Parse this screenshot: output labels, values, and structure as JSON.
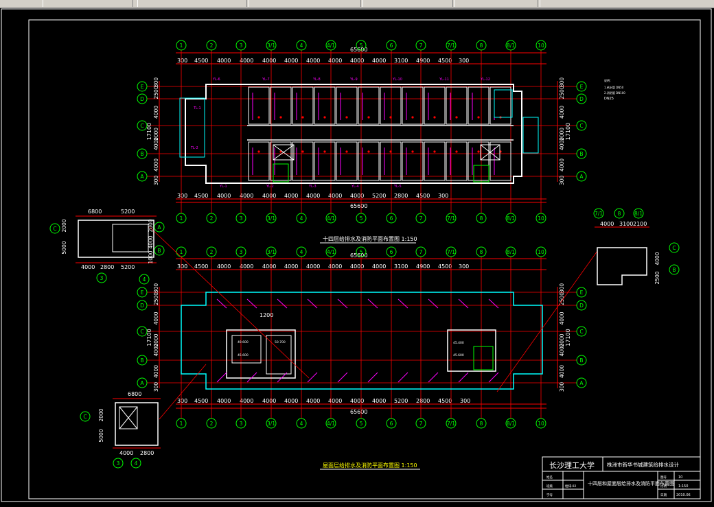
{
  "toolbar": {
    "segments": [
      "",
      "",
      "",
      "",
      "",
      ""
    ]
  },
  "plan_top": {
    "top_axes": [
      "1",
      "2",
      "3",
      "3/1",
      "4",
      "4/1",
      "5",
      "6",
      "7",
      "7/1",
      "8",
      "8/1",
      "10"
    ],
    "top_dims": [
      "300",
      "4500",
      "4000",
      "4000",
      "4000",
      "4000",
      "4000",
      "4000",
      "4000",
      "4000",
      "3100",
      "4900",
      "4500",
      "300"
    ],
    "bottom_dims": [
      "300",
      "4500",
      "4000",
      "4000",
      "4000",
      "4000",
      "4000",
      "4000",
      "4000",
      "5200",
      "2800",
      "4500",
      "300"
    ],
    "overall": "65600",
    "row_axes": [
      "E",
      "D",
      "C",
      "B",
      "A"
    ],
    "left_dims": [
      "300",
      "2500",
      "4000",
      "2000",
      "4000",
      "4000",
      "300"
    ],
    "left_total": "17100",
    "title": "十四层给排水及消防平面布置图 1:150",
    "pipes": [
      "YL-6",
      "YL-7",
      "YL-8",
      "YL-9",
      "YL-10",
      "YL-11",
      "YL-12",
      "YL-1",
      "YL-2",
      "YL-3",
      "YL-4",
      "YL-5",
      "TL-1",
      "TL-2"
    ],
    "notes": [
      "说明：",
      "1.给水管 DN50",
      "2.消防管 DN100",
      "DN25"
    ]
  },
  "plan_bottom": {
    "top_dims": [
      "300",
      "4500",
      "4000",
      "4000",
      "4000",
      "4000",
      "4000",
      "4000",
      "4000",
      "4000",
      "3100",
      "4900",
      "4500",
      "300"
    ],
    "bottom_dims": [
      "300",
      "4500",
      "4000",
      "4000",
      "4000",
      "4000",
      "4000",
      "4000",
      "4000",
      "4000",
      "5200",
      "2800",
      "4500",
      "300"
    ],
    "overall": "65600",
    "dim_1200": "1200",
    "title": "屋面层给排水及消防平面布置图 1:150",
    "labels": [
      "49.600",
      "50.700",
      "45.600",
      "45.400",
      "45.600"
    ]
  },
  "detail_left_top": {
    "dims_top": [
      "6800",
      "5200"
    ],
    "dims_bottom": [
      "4000",
      "2800",
      "5200"
    ],
    "dims_left": [
      "5000",
      "2000"
    ],
    "dims_right": [
      "2000",
      "4000",
      "1000"
    ],
    "axes": [
      "C",
      "3",
      "4",
      "B",
      "A"
    ]
  },
  "detail_right_top": {
    "dims_top": [
      "4000",
      "3100",
      "2100"
    ],
    "axes_top": [
      "7/1",
      "8",
      "8/1"
    ],
    "dims_right": [
      "2500",
      "4000"
    ],
    "axes": [
      "C",
      "B"
    ]
  },
  "detail_left_bottom": {
    "dims_top": [
      "6800"
    ],
    "dims_bottom": [
      "4000",
      "2800"
    ],
    "dims_left": [
      "5000",
      "2000"
    ],
    "axes": [
      "C",
      "3",
      "4"
    ]
  },
  "title_block": {
    "school": "长沙理工大学",
    "project": "株洲市新华书城建筑给排水设计",
    "drawing": "十四层和屋面层给排水及消防平面布置图",
    "row_labels": [
      "姓名",
      "班级",
      "学号",
      "图号",
      "比例",
      "日期"
    ],
    "row_values": [
      "",
      "给排-02",
      "",
      "10",
      "1:150",
      "2010.06"
    ]
  },
  "colors": {
    "grid": "#ff0000",
    "axis": "#00ff00",
    "dim": "#ffffff",
    "wall": "#ffffff",
    "pipe": "#ff00ff",
    "accent": "#00ffff",
    "text": "#ffff00"
  }
}
